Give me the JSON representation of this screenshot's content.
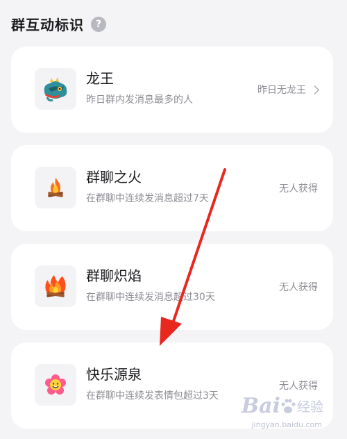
{
  "header": {
    "title": "群互动标识",
    "help_glyph": "?"
  },
  "cards": [
    {
      "icon": "dragon-icon",
      "title": "龙王",
      "desc": "昨日群内发消息最多的人",
      "status": "昨日无龙王",
      "has_chevron": true
    },
    {
      "icon": "campfire-icon",
      "title": "群聊之火",
      "desc": "在群聊中连续发消息超过7天",
      "status": "无人获得"
    },
    {
      "icon": "blaze-icon",
      "title": "群聊炽焰",
      "desc": "在群聊中连续发消息超过30天",
      "status": "无人获得"
    },
    {
      "icon": "smiling-flower-icon",
      "title": "快乐源泉",
      "desc": "在群聊中连续发表情包超过3天",
      "status": "无人获得"
    }
  ],
  "annotation": {
    "arrow_color": "#e8271f"
  },
  "watermark": {
    "logo": "Bai",
    "text": "经验",
    "url": "jingyan.baidu.com"
  }
}
